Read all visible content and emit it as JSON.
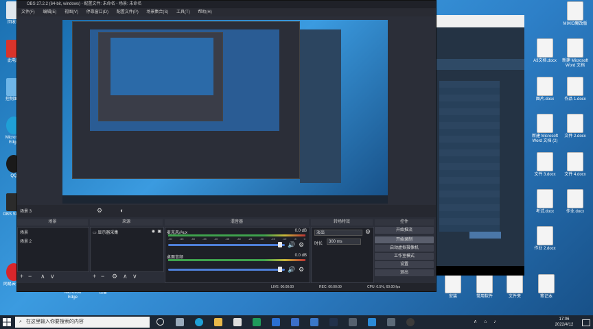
{
  "obs": {
    "title": "OBS 27.2.2 (64-bit, windows) - 配置文件: 未命名 - 场景: 未命名",
    "menu": [
      "文件(F)",
      "编辑(E)",
      "视图(V)",
      "停靠窗口(D)",
      "配置文件(P)",
      "场景集合(S)",
      "工具(T)",
      "帮助(H)"
    ],
    "status_left": "场景 3",
    "docks": {
      "scenes": "场景",
      "sources": "来源",
      "mixer": "混音器",
      "transitions": "转场特效",
      "controls": "控件"
    },
    "scenes": [
      "场景",
      "场景 2"
    ],
    "sources": [
      {
        "name": "显示器采集"
      }
    ],
    "mixer": [
      {
        "name": "麦克风/Aux",
        "db": "0.0 dB"
      },
      {
        "name": "桌面音频",
        "db": "0.0 dB"
      }
    ],
    "meter_ticks": [
      "-60",
      "-55",
      "-50",
      "-45",
      "-40",
      "-35",
      "-30",
      "-25",
      "-20",
      "-15",
      "-10",
      "-5",
      "0"
    ],
    "transitions": {
      "type": "淡出",
      "duration_label": "时长",
      "duration": "300 ms"
    },
    "controls": [
      "开始推流",
      "开始录制",
      "启动虚拟摄像机",
      "工作室模式",
      "设置",
      "退出"
    ],
    "statusbar": {
      "live": "LIVE: 00:00:00",
      "rec": "REC: 00:00:00",
      "cpu": "CPU: 0.5%, 60.00 fps"
    }
  },
  "desktop": {
    "left_icons": [
      "回收站",
      "此电脑",
      "控制面板",
      "Microsoft Edge",
      "QQ",
      "OBS Studio",
      "网易云音乐"
    ],
    "bottom_icons": [
      "Microsoft Edge",
      "迅雷"
    ],
    "right_icons": [
      "MIXIO魔改版",
      "A3文档.docx",
      "新建 Microsoft Word 文档",
      "图片.docx",
      "作品 1.docx",
      "新建 Microsoft Word 文档 (2)",
      "文件 2.docx",
      "文件 3.docx",
      "文件 4.docx",
      "考试.docx",
      "作业.docx",
      "作业 2.docx",
      "安装",
      "常用软件",
      "文件夹",
      "笔记本"
    ]
  },
  "taskbar": {
    "search_placeholder": "在这里输入你要搜索的内容",
    "time": "17:06",
    "date": "2022/4/12"
  }
}
